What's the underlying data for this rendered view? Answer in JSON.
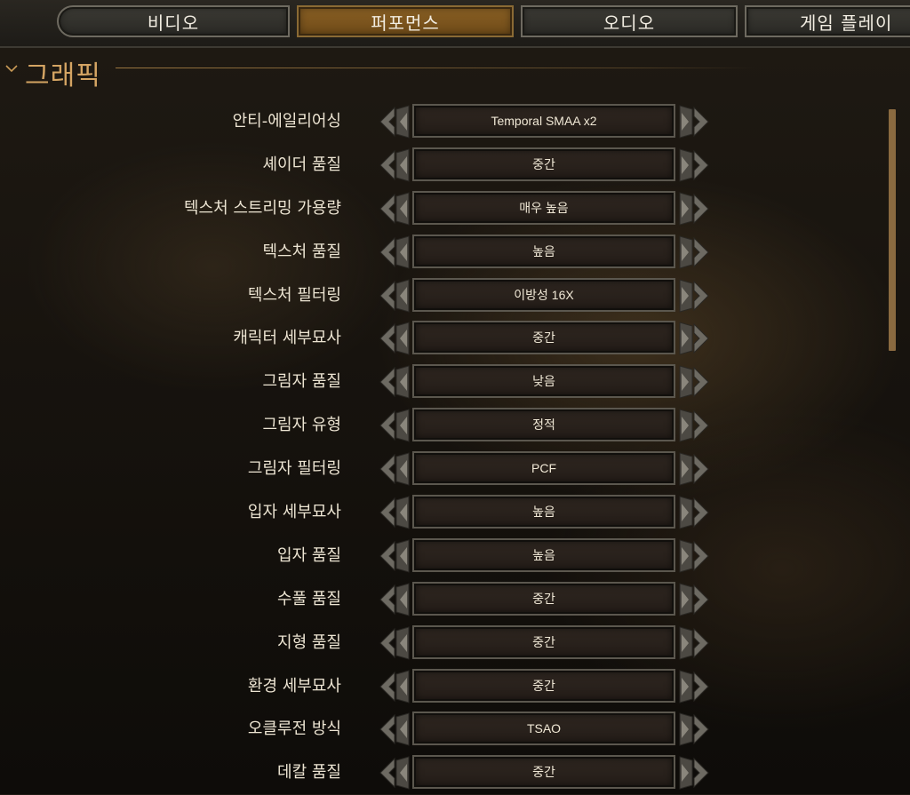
{
  "tabs": [
    {
      "label": "비디오",
      "active": false
    },
    {
      "label": "퍼포먼스",
      "active": true
    },
    {
      "label": "오디오",
      "active": false
    },
    {
      "label": "게임 플레이",
      "active": false
    }
  ],
  "section": {
    "title": "그래픽",
    "collapse_icon": "chevron-down-icon"
  },
  "settings": [
    {
      "label": "안티-에일리어싱",
      "value": "Temporal SMAA x2"
    },
    {
      "label": "셰이더 품질",
      "value": "중간"
    },
    {
      "label": "텍스처 스트리밍 가용량",
      "value": "매우 높음"
    },
    {
      "label": "텍스처 품질",
      "value": "높음"
    },
    {
      "label": "텍스처 필터링",
      "value": "이방성 16X"
    },
    {
      "label": "캐릭터 세부묘사",
      "value": "중간"
    },
    {
      "label": "그림자 품질",
      "value": "낮음"
    },
    {
      "label": "그림자 유형",
      "value": "정적"
    },
    {
      "label": "그림자 필터링",
      "value": "PCF"
    },
    {
      "label": "입자 세부묘사",
      "value": "높음"
    },
    {
      "label": "입자 품질",
      "value": "높음"
    },
    {
      "label": "수풀 품질",
      "value": "중간"
    },
    {
      "label": "지형 품질",
      "value": "중간"
    },
    {
      "label": "환경 세부묘사",
      "value": "중간"
    },
    {
      "label": "오클루전 방식",
      "value": "TSAO"
    },
    {
      "label": "데칼 품질",
      "value": "중간"
    }
  ],
  "colors": {
    "accent": "#c99a56",
    "active_tab": "#7a5420",
    "text": "#ece4d2"
  }
}
